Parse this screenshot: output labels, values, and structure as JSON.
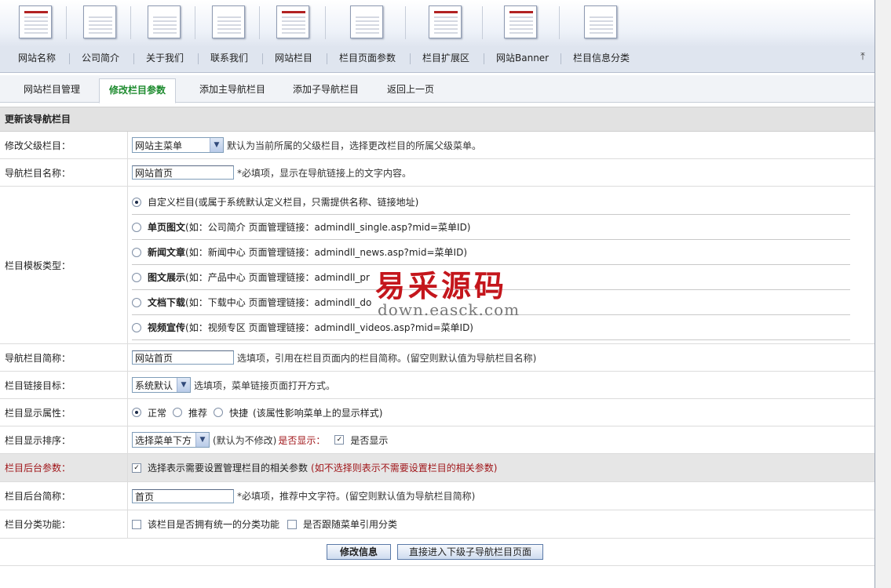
{
  "nav": [
    "网站名称",
    "公司简介",
    "关于我们",
    "联系我们",
    "网站栏目",
    "栏目页面参数",
    "栏目扩展区",
    "网站Banner",
    "栏目信息分类"
  ],
  "tabs": [
    "网站栏目管理",
    "修改栏目参数",
    "添加主导航栏目",
    "添加子导航栏目",
    "返回上一页"
  ],
  "active_tab": "修改栏目参数",
  "section_title": "更新该导航栏目",
  "parent": {
    "label": "修改父级栏目：",
    "value": "网站主菜单",
    "hint": "默认为当前所属的父级栏目，选择更改栏目的所属父级菜单。"
  },
  "nav_name": {
    "label": "导航栏目名称：",
    "value": "网站首页",
    "hint": "*必填项，显示在导航链接上的文字内容。"
  },
  "template": {
    "label": "栏目模板类型：",
    "options": [
      {
        "title": "",
        "desc": "自定义栏目(或属于系统默认定义栏目，只需提供名称、链接地址)",
        "checked": true
      },
      {
        "title": "单页图文",
        "desc": "(如：公司简介 页面管理链接：admindll_single.asp?mid=菜单ID)",
        "checked": false
      },
      {
        "title": "新闻文章",
        "desc": "(如：新闻中心 页面管理链接：admindll_news.asp?mid=菜单ID)",
        "checked": false
      },
      {
        "title": "图文展示",
        "desc": "(如：产品中心 页面管理链接：admindll_pr",
        "checked": false
      },
      {
        "title": "文档下载",
        "desc": "(如：下载中心 页面管理链接：admindll_do",
        "checked": false
      },
      {
        "title": "视频宣传",
        "desc": "(如：视频专区 页面管理链接：admindll_videos.asp?mid=菜单ID)",
        "checked": false
      }
    ]
  },
  "short_name": {
    "label": "导航栏目简称：",
    "value": "网站首页",
    "hint": "选填项，引用在栏目页面内的栏目简称。(留空则默认值为导航栏目名称)"
  },
  "link_target": {
    "label": "栏目链接目标：",
    "value": "系统默认",
    "hint": "选填项，菜单链接页面打开方式。"
  },
  "display_attr": {
    "label": "栏目显示属性：",
    "options": [
      "正常",
      "推荐",
      "快捷"
    ],
    "checked": "正常",
    "hint": "(该属性影响菜单上的显示样式)"
  },
  "display_order": {
    "label": "栏目显示排序：",
    "value": "选择菜单下方",
    "hint": "(默认为不修改)",
    "show_label": "是否显示：",
    "show_check": "是否显示",
    "show_checked": true
  },
  "backend_params": {
    "label": "栏目后台参数：",
    "check_text": "选择表示需要设置管理栏目的相关参数",
    "note": "(如不选择则表示不需要设置栏目的相关参数)",
    "checked": true
  },
  "backend_short": {
    "label": "栏目后台简称：",
    "value": "首页",
    "hint": "*必填项，推荐中文字符。(留空则默认值为导航栏目简称)"
  },
  "category": {
    "label": "栏目分类功能：",
    "opt1": "该栏目是否拥有统一的分类功能",
    "opt2": "是否跟随菜单引用分类"
  },
  "buttons": {
    "submit": "修改信息",
    "goto": "直接进入下级子导航栏目页面"
  },
  "watermark": {
    "cn": "易采源码",
    "url": "down.easck.com"
  }
}
